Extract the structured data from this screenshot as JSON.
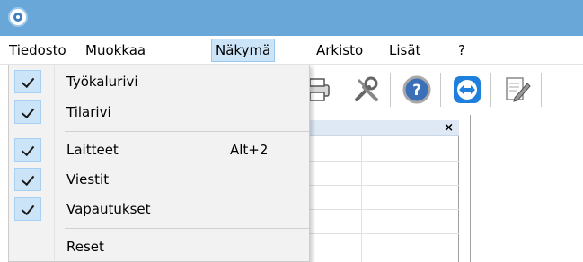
{
  "menubar": {
    "items": [
      {
        "label": "Tiedosto"
      },
      {
        "label": "Muokkaa"
      },
      {
        "label": "Näkymä"
      },
      {
        "label": "Arkisto"
      },
      {
        "label": "Lisät"
      },
      {
        "label": "?"
      }
    ],
    "active_item": "Näkymä"
  },
  "view_menu": {
    "items": [
      {
        "label": "Työkalurivi",
        "checked": true,
        "shortcut": ""
      },
      {
        "label": "Tilarivi",
        "checked": true,
        "shortcut": ""
      },
      {
        "label": "Laitteet",
        "checked": true,
        "shortcut": "Alt+2"
      },
      {
        "label": "Viestit",
        "checked": true,
        "shortcut": ""
      },
      {
        "label": "Vapautukset",
        "checked": true,
        "shortcut": ""
      },
      {
        "label": "Reset",
        "checked": false,
        "shortcut": ""
      }
    ]
  },
  "toolbar": {
    "icons": [
      "printer-icon",
      "tools-icon",
      "help-icon",
      "remote-support-icon",
      "edit-document-icon"
    ]
  },
  "panel": {
    "close_label": "×"
  },
  "colors": {
    "titlebar": "#68a7d8",
    "menu_highlight": "#cce4f7",
    "check_highlight": "#cce4f7"
  }
}
